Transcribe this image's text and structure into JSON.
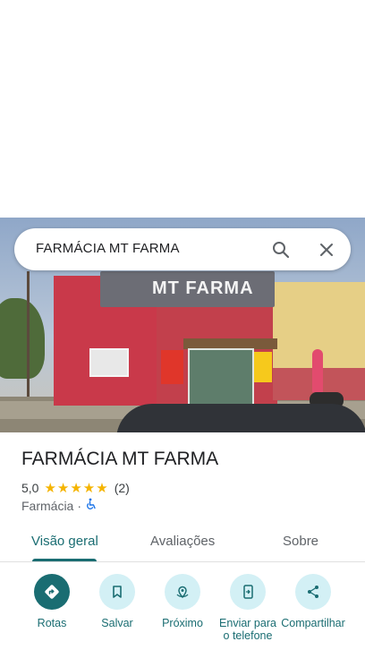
{
  "search": {
    "query": "FARMÁCIA MT FARMA"
  },
  "photo": {
    "sign_text": "MT FARMA"
  },
  "place": {
    "name": "FARMÁCIA MT FARMA",
    "rating": "5,0",
    "stars": "★★★★★",
    "review_count": "(2)",
    "category": "Farmácia",
    "separator": "·",
    "accessibility_icon": "wheelchair-icon"
  },
  "tabs": [
    {
      "label": "Visão geral",
      "active": true
    },
    {
      "label": "Avaliações",
      "active": false
    },
    {
      "label": "Sobre",
      "active": false
    }
  ],
  "actions": [
    {
      "label": "Rotas",
      "icon": "directions-icon"
    },
    {
      "label": "Salvar",
      "icon": "bookmark-icon"
    },
    {
      "label": "Próximo",
      "icon": "nearby-icon"
    },
    {
      "label": "Enviar para o telefone",
      "icon": "send-to-phone-icon"
    },
    {
      "label": "Compartilhar",
      "icon": "share-icon"
    }
  ],
  "colors": {
    "accent": "#1a6d72",
    "action_bg": "#d3f0f5",
    "star": "#f5b400"
  }
}
